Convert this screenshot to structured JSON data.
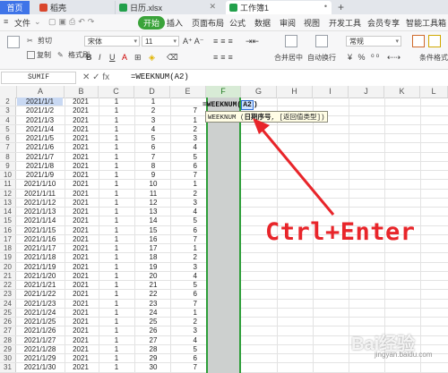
{
  "tabs": [
    {
      "label": "首页"
    },
    {
      "label": "稻壳"
    },
    {
      "label": "日历.xlsx"
    },
    {
      "label": "工作簿1"
    }
  ],
  "menu": [
    "文件",
    "开始",
    "插入",
    "页面布局",
    "公式",
    "数据",
    "审阅",
    "视图",
    "开发工具",
    "会员专享",
    "智能工具箱"
  ],
  "ribbon": {
    "cut": "剪切",
    "copy": "复制",
    "format_painter": "格式刷",
    "font": "宋体",
    "font_size": "11",
    "merge": "合并居中",
    "wrap": "自动换行",
    "number_format": "常规",
    "cond_format": "条件格式"
  },
  "formula_bar": {
    "name_box": "SUMIF",
    "icons": "✕ ✓ fx",
    "formula": "=WEEKNUM(A2)"
  },
  "columns": [
    "A",
    "B",
    "C",
    "D",
    "E",
    "F",
    "G",
    "H",
    "I",
    "J",
    "K",
    "L"
  ],
  "editing": {
    "func": "=WEEKNUM(",
    "ref": "A2",
    "close": ")",
    "tooltip_prefix": "WEEKNUM (",
    "tooltip_arg1": "日期序号",
    "tooltip_rest": ", [返回值类型])"
  },
  "rows": [
    {
      "n": "2",
      "date": "2021/1/1",
      "year": "2021",
      "c": "1",
      "d": "1",
      "e": ""
    },
    {
      "n": "3",
      "date": "2021/1/2",
      "year": "2021",
      "c": "1",
      "d": "2",
      "e": "7"
    },
    {
      "n": "4",
      "date": "2021/1/3",
      "year": "2021",
      "c": "1",
      "d": "3",
      "e": "1"
    },
    {
      "n": "5",
      "date": "2021/1/4",
      "year": "2021",
      "c": "1",
      "d": "4",
      "e": "2"
    },
    {
      "n": "6",
      "date": "2021/1/5",
      "year": "2021",
      "c": "1",
      "d": "5",
      "e": "3"
    },
    {
      "n": "7",
      "date": "2021/1/6",
      "year": "2021",
      "c": "1",
      "d": "6",
      "e": "4"
    },
    {
      "n": "8",
      "date": "2021/1/7",
      "year": "2021",
      "c": "1",
      "d": "7",
      "e": "5"
    },
    {
      "n": "9",
      "date": "2021/1/8",
      "year": "2021",
      "c": "1",
      "d": "8",
      "e": "6"
    },
    {
      "n": "10",
      "date": "2021/1/9",
      "year": "2021",
      "c": "1",
      "d": "9",
      "e": "7"
    },
    {
      "n": "11",
      "date": "2021/1/10",
      "year": "2021",
      "c": "1",
      "d": "10",
      "e": "1"
    },
    {
      "n": "12",
      "date": "2021/1/11",
      "year": "2021",
      "c": "1",
      "d": "11",
      "e": "2"
    },
    {
      "n": "13",
      "date": "2021/1/12",
      "year": "2021",
      "c": "1",
      "d": "12",
      "e": "3"
    },
    {
      "n": "14",
      "date": "2021/1/13",
      "year": "2021",
      "c": "1",
      "d": "13",
      "e": "4"
    },
    {
      "n": "15",
      "date": "2021/1/14",
      "year": "2021",
      "c": "1",
      "d": "14",
      "e": "5"
    },
    {
      "n": "16",
      "date": "2021/1/15",
      "year": "2021",
      "c": "1",
      "d": "15",
      "e": "6"
    },
    {
      "n": "17",
      "date": "2021/1/16",
      "year": "2021",
      "c": "1",
      "d": "16",
      "e": "7"
    },
    {
      "n": "18",
      "date": "2021/1/17",
      "year": "2021",
      "c": "1",
      "d": "17",
      "e": "1"
    },
    {
      "n": "19",
      "date": "2021/1/18",
      "year": "2021",
      "c": "1",
      "d": "18",
      "e": "2"
    },
    {
      "n": "20",
      "date": "2021/1/19",
      "year": "2021",
      "c": "1",
      "d": "19",
      "e": "3"
    },
    {
      "n": "21",
      "date": "2021/1/20",
      "year": "2021",
      "c": "1",
      "d": "20",
      "e": "4"
    },
    {
      "n": "22",
      "date": "2021/1/21",
      "year": "2021",
      "c": "1",
      "d": "21",
      "e": "5"
    },
    {
      "n": "23",
      "date": "2021/1/22",
      "year": "2021",
      "c": "1",
      "d": "22",
      "e": "6"
    },
    {
      "n": "24",
      "date": "2021/1/23",
      "year": "2021",
      "c": "1",
      "d": "23",
      "e": "7"
    },
    {
      "n": "25",
      "date": "2021/1/24",
      "year": "2021",
      "c": "1",
      "d": "24",
      "e": "1"
    },
    {
      "n": "26",
      "date": "2021/1/25",
      "year": "2021",
      "c": "1",
      "d": "25",
      "e": "2"
    },
    {
      "n": "27",
      "date": "2021/1/26",
      "year": "2021",
      "c": "1",
      "d": "26",
      "e": "3"
    },
    {
      "n": "28",
      "date": "2021/1/27",
      "year": "2021",
      "c": "1",
      "d": "27",
      "e": "4"
    },
    {
      "n": "29",
      "date": "2021/1/28",
      "year": "2021",
      "c": "1",
      "d": "28",
      "e": "5"
    },
    {
      "n": "30",
      "date": "2021/1/29",
      "year": "2021",
      "c": "1",
      "d": "29",
      "e": "6"
    },
    {
      "n": "31",
      "date": "2021/1/30",
      "year": "2021",
      "c": "1",
      "d": "30",
      "e": "7"
    }
  ],
  "annotation": "Ctrl+Enter",
  "watermark": "Bai经验",
  "watermark_sub": "jingyan.baidu.com",
  "colors": {
    "selection_border": "#2e9e3a",
    "annotation": "#e8252a",
    "start_tab": "#3aa33a",
    "home_tab": "#3f74e8"
  }
}
